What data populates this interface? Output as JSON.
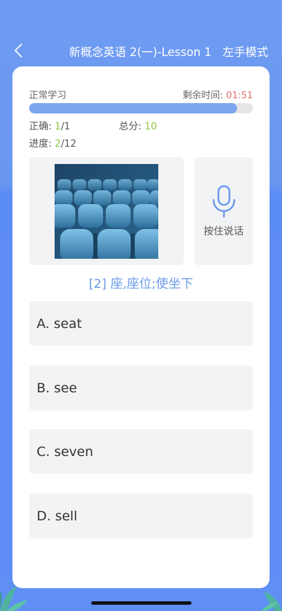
{
  "header": {
    "back_icon": "chevron-left-icon",
    "title": "新概念英语 2(一)-Lesson 1",
    "mode_toggle": "左手模式"
  },
  "status": {
    "mode": "正常学习",
    "time_label": "剩余时间:",
    "time_value": "01:51",
    "progress_fraction": 0.93
  },
  "stats": {
    "correct_label": "正确:",
    "correct_value": "1",
    "correct_total": "/1",
    "score_label": "总分:",
    "score_value": "10",
    "progress_label": "进度:",
    "progress_value": "2",
    "progress_total": "/12"
  },
  "media": {
    "image_subject": "theater seats photo",
    "mic_icon": "microphone-icon",
    "mic_label": "按住说话"
  },
  "question": {
    "text": "[2] 座,座位;使坐下"
  },
  "options": [
    {
      "label": "A. seat"
    },
    {
      "label": "B. see"
    },
    {
      "label": "C. seven"
    },
    {
      "label": "D. sell"
    }
  ],
  "colors": {
    "accent": "#6c9be8",
    "progress": "#7ea6ef",
    "timer": "#e07070",
    "highlight": "#8cc63f"
  }
}
